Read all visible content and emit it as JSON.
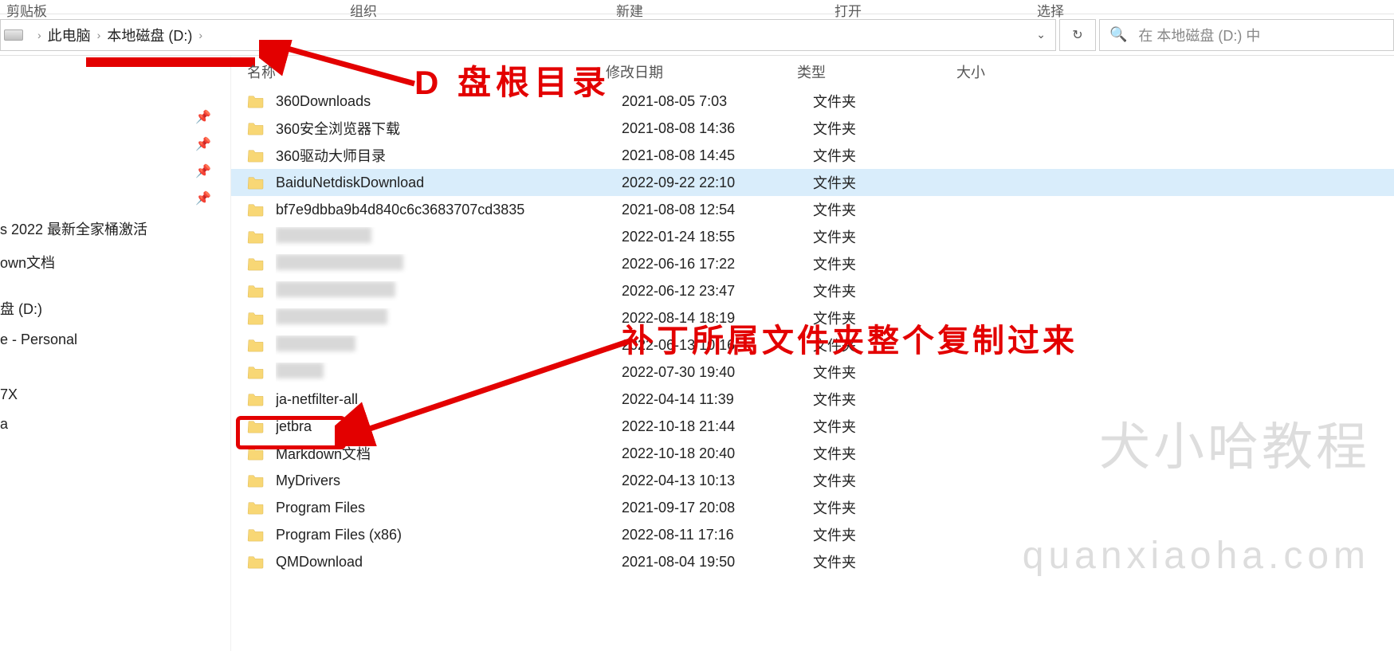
{
  "toolbar": {
    "clipboard": "剪贴板",
    "organize": "组织",
    "new": "新建",
    "open": "打开",
    "select": "选择"
  },
  "breadcrumb": {
    "pc": "此电脑",
    "drive": "本地磁盘 (D:)"
  },
  "search": {
    "placeholder": "在 本地磁盘 (D:) 中"
  },
  "columns": {
    "name": "名称",
    "date": "修改日期",
    "type": "类型",
    "size": "大小"
  },
  "sidebar": {
    "items": [
      "s 2022 最新全家桶激活",
      "own文档",
      "",
      "盘 (D:)",
      "e - Personal",
      "",
      "",
      "7X",
      "a"
    ]
  },
  "folder_type": "文件夹",
  "files": [
    {
      "name": "360Downloads",
      "date": "2021-08-05 7:03",
      "type": "文件夹",
      "blurred": false
    },
    {
      "name": "360安全浏览器下载",
      "date": "2021-08-08 14:36",
      "type": "文件夹",
      "blurred": false
    },
    {
      "name": "360驱动大师目录",
      "date": "2021-08-08 14:45",
      "type": "文件夹",
      "blurred": false
    },
    {
      "name": "BaiduNetdiskDownload",
      "date": "2022-09-22 22:10",
      "type": "文件夹",
      "blurred": false,
      "selected": true
    },
    {
      "name": "bf7e9dbba9b4d840c6c3683707cd3835",
      "date": "2021-08-08 12:54",
      "type": "文件夹",
      "blurred": false
    },
    {
      "name": "",
      "date": "2022-01-24 18:55",
      "type": "文件夹",
      "blurred": true,
      "bw": 120
    },
    {
      "name": "",
      "date": "2022-06-16 17:22",
      "type": "文件夹",
      "blurred": true,
      "bw": 160
    },
    {
      "name": "",
      "date": "2022-06-12 23:47",
      "type": "文件夹",
      "blurred": true,
      "bw": 150
    },
    {
      "name": "",
      "date": "2022-08-14 18:19",
      "type": "文件夹",
      "blurred": true,
      "bw": 140
    },
    {
      "name": "",
      "date": "2022-06-13 10:16",
      "type": "文件夹",
      "blurred": true,
      "bw": 100
    },
    {
      "name": "",
      "date": "2022-07-30 19:40",
      "type": "文件夹",
      "blurred": true,
      "bw": 60
    },
    {
      "name": "ja-netfilter-all",
      "date": "2022-04-14 11:39",
      "type": "文件夹",
      "blurred": false
    },
    {
      "name": "jetbra",
      "date": "2022-10-18 21:44",
      "type": "文件夹",
      "blurred": false
    },
    {
      "name": "Markdown文档",
      "date": "2022-10-18 20:40",
      "type": "文件夹",
      "blurred": false
    },
    {
      "name": "MyDrivers",
      "date": "2022-04-13 10:13",
      "type": "文件夹",
      "blurred": false
    },
    {
      "name": "Program Files",
      "date": "2021-09-17 20:08",
      "type": "文件夹",
      "blurred": false
    },
    {
      "name": "Program Files (x86)",
      "date": "2022-08-11 17:16",
      "type": "文件夹",
      "blurred": false
    },
    {
      "name": "QMDownload",
      "date": "2021-08-04 19:50",
      "type": "文件夹",
      "blurred": false
    }
  ],
  "annotations": {
    "root_label": "D 盘根目录",
    "copy_label": "补丁所属文件夹整个复制过来"
  },
  "watermarks": {
    "line1": "犬小哈教程",
    "line2": "quanxiaoha.com"
  }
}
